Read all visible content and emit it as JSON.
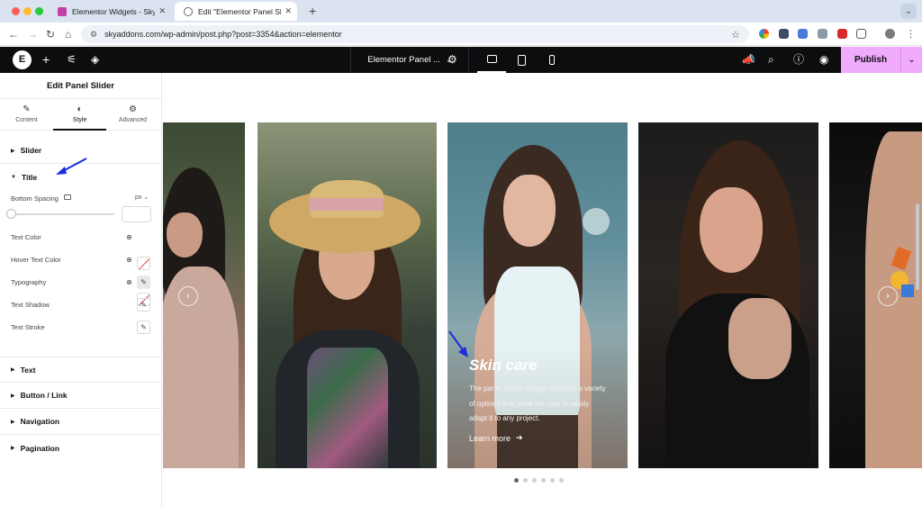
{
  "browser": {
    "tabs": [
      {
        "title": "Elementor Widgets - Sky Addons",
        "active": false
      },
      {
        "title": "Edit \"Elementor Panel Slider\"",
        "active": true
      }
    ],
    "new_tab": "+",
    "menu": "⌄",
    "url": "skyaddons.com/wp-admin/post.php?post=3354&action=elementor"
  },
  "elementor_bar": {
    "logo": "E",
    "document_title": "Elementor Panel ...",
    "publish_label": "Publish",
    "icons": [
      "elementor-logo-icon",
      "add-element-icon",
      "site-settings-icon",
      "structure-layers-icon",
      "page-settings-gear-icon",
      "desktop-icon",
      "tablet-icon",
      "mobile-icon",
      "whats-new-icon",
      "search-icon",
      "help-icon",
      "preview-eye-icon",
      "publish-chevron-icon"
    ]
  },
  "panel": {
    "title": "Edit Panel Slider",
    "tabs": [
      {
        "label": "Content",
        "icon": "pencil-icon"
      },
      {
        "label": "Style",
        "icon": "contrast-icon",
        "active": true
      },
      {
        "label": "Advanced",
        "icon": "gear-icon"
      }
    ],
    "sections": {
      "slider": "Slider",
      "title": "Title",
      "text": "Text",
      "button": "Button / Link",
      "navigation": "Navigation",
      "pagination": "Pagination"
    },
    "controls": {
      "bottom_spacing": "Bottom Spacing",
      "unit": "px ⌄",
      "spacing_value": "",
      "text_color": "Text Color",
      "hover_text_color": "Hover Text Color",
      "typography": "Typography",
      "text_shadow": "Text Shadow",
      "text_stroke": "Text Stroke"
    }
  },
  "slider": {
    "active_title": "Skin care",
    "active_description": "The panel sliders design provides a variety of options that allow the user to easily adapt it to any project.",
    "link_label": "Learn more",
    "prev_arrow": "‹",
    "next_arrow": "›",
    "dots_total": 6,
    "dots_active_index": 0
  },
  "colors": {
    "publish_bg": "#f0abfc",
    "elementor_bar": "#0c0d0e",
    "annotation_arrow": "#1a2be0"
  }
}
